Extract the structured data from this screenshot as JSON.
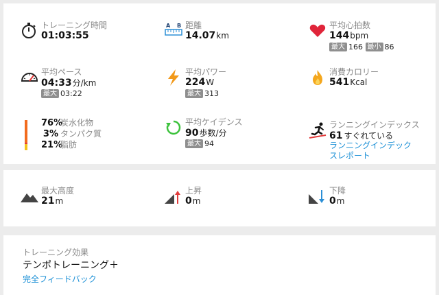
{
  "training_time": {
    "label": "トレーニング時間",
    "value": "01:03:55"
  },
  "distance": {
    "label": "距離",
    "value": "14.07",
    "unit": "km"
  },
  "avg_hr": {
    "label": "平均心拍数",
    "value": "144",
    "unit": "bpm",
    "max_badge": "最大",
    "max_value": "166",
    "min_badge": "最小",
    "min_value": "86"
  },
  "avg_pace": {
    "label": "平均ペース",
    "value": "04:33",
    "unit": "分/km",
    "max_badge": "最大",
    "max_value": "03:22"
  },
  "avg_power": {
    "label": "平均パワー",
    "value": "224",
    "unit": "W",
    "max_badge": "最大",
    "max_value": "313"
  },
  "calories": {
    "label": "消費カロリー",
    "value": "541",
    "unit": "Kcal"
  },
  "macros": {
    "carb": {
      "pct": "76%",
      "name": "炭水化物"
    },
    "protein": {
      "pct": "3%",
      "name": "タンパク質"
    },
    "fat": {
      "pct": "21%",
      "name": "脂肪"
    },
    "colors": {
      "carb": "#f26b1d",
      "protein": "#e23b3b",
      "fat": "#f4c21a"
    }
  },
  "avg_cadence": {
    "label": "平均ケイデンス",
    "value": "90",
    "unit": "歩数/分",
    "max_badge": "最大",
    "max_value": "94"
  },
  "running_index": {
    "label": "ランニングインデックス",
    "value": "61",
    "desc": "すぐれている",
    "link": "ランニングインデックスレポート"
  },
  "elevation": {
    "max": {
      "label": "最大高度",
      "value": "21",
      "unit": "m"
    },
    "ascent": {
      "label": "上昇",
      "value": "0",
      "unit": "m"
    },
    "descent": {
      "label": "下降",
      "value": "0",
      "unit": "m"
    }
  },
  "training_effect": {
    "label": "トレーニング効果",
    "value": "テンポトレーニング＋",
    "link": "完全フィードバック"
  },
  "colors": {
    "link": "#1a8fd6",
    "heart": "#e0253a",
    "power": "#f2991a",
    "fire": "#f4a71d",
    "cadence": "#3cc23c",
    "ascent_arrow": "#e23b3b",
    "descent_arrow": "#2b8fd6"
  }
}
